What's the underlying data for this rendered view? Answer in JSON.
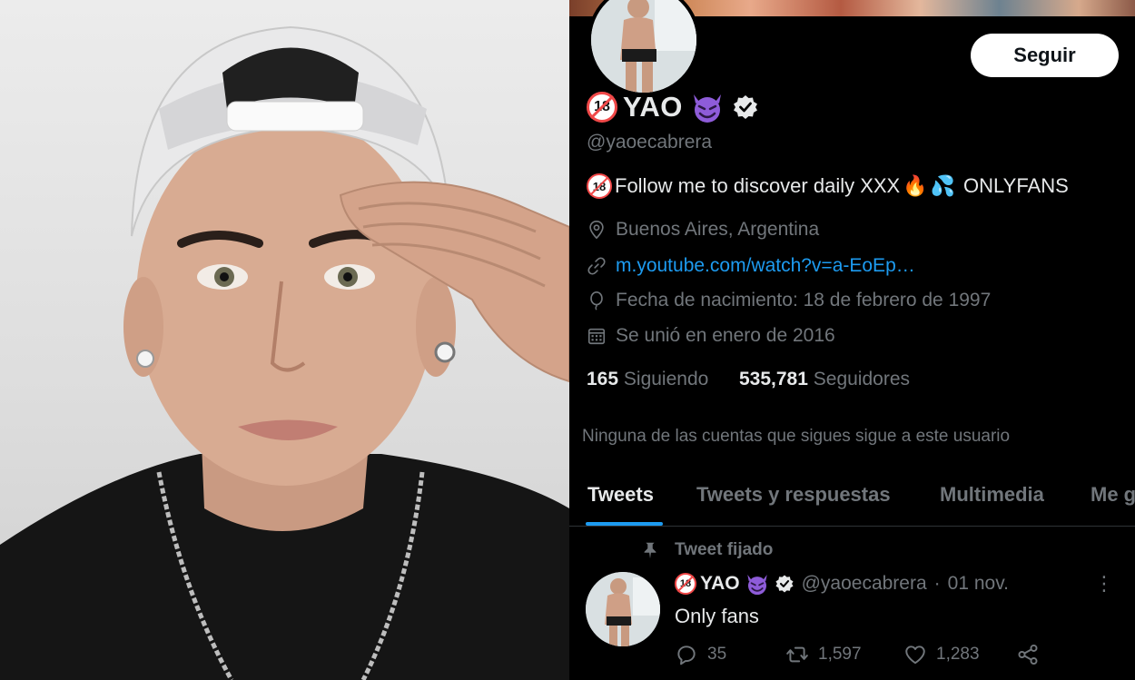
{
  "profile": {
    "follow_label": "Seguir",
    "badge_text": "18",
    "name": "YAO",
    "handle": "@yaoecabrera",
    "bio": {
      "badge_text": "18",
      "text": "Follow me to discover daily XXX",
      "emoji_fire": "🔥",
      "emoji_drops": "💦",
      "suffix": "ONLYFANS"
    },
    "location": "Buenos Aires, Argentina",
    "website": "m.youtube.com/watch?v=a-EoEp…",
    "birthday": "Fecha de nacimiento: 18 de febrero de 1997",
    "joined": "Se unió en enero de 2016",
    "following_count": "165",
    "following_label": "Siguiendo",
    "followers_count": "535,781",
    "followers_label": "Seguidores",
    "followers_note": "Ninguna de las cuentas que sigues sigue a este usuario"
  },
  "tabs": [
    {
      "label": "Tweets",
      "active": true
    },
    {
      "label": "Tweets y respuestas",
      "active": false
    },
    {
      "label": "Multimedia",
      "active": false
    },
    {
      "label": "Me g",
      "active": false
    }
  ],
  "pinned_tweet": {
    "pinned_label": "Tweet fijado",
    "badge_text": "18",
    "author_name": "YAO",
    "author_handle": "@yaoecabrera",
    "separator": "·",
    "date": "01 nov.",
    "text": "Only fans",
    "replies": "35",
    "retweets": "1,597",
    "likes": "1,283",
    "more_icon": "⋮"
  },
  "icons": {
    "location": "location-pin-icon",
    "link": "link-icon",
    "birthday": "balloon-icon",
    "calendar": "calendar-icon",
    "verified": "verified-badge-icon",
    "devil": "smiling-devil-emoji-icon",
    "pin": "pin-icon",
    "reply": "reply-icon",
    "retweet": "retweet-icon",
    "like": "heart-icon",
    "share": "share-icon"
  },
  "colors": {
    "background": "#000000",
    "text_primary": "#e7e9ea",
    "text_secondary": "#71767b",
    "accent": "#1d9bf0",
    "follow_button_bg": "#ffffff",
    "devil_purple": "#8e5cd9"
  }
}
